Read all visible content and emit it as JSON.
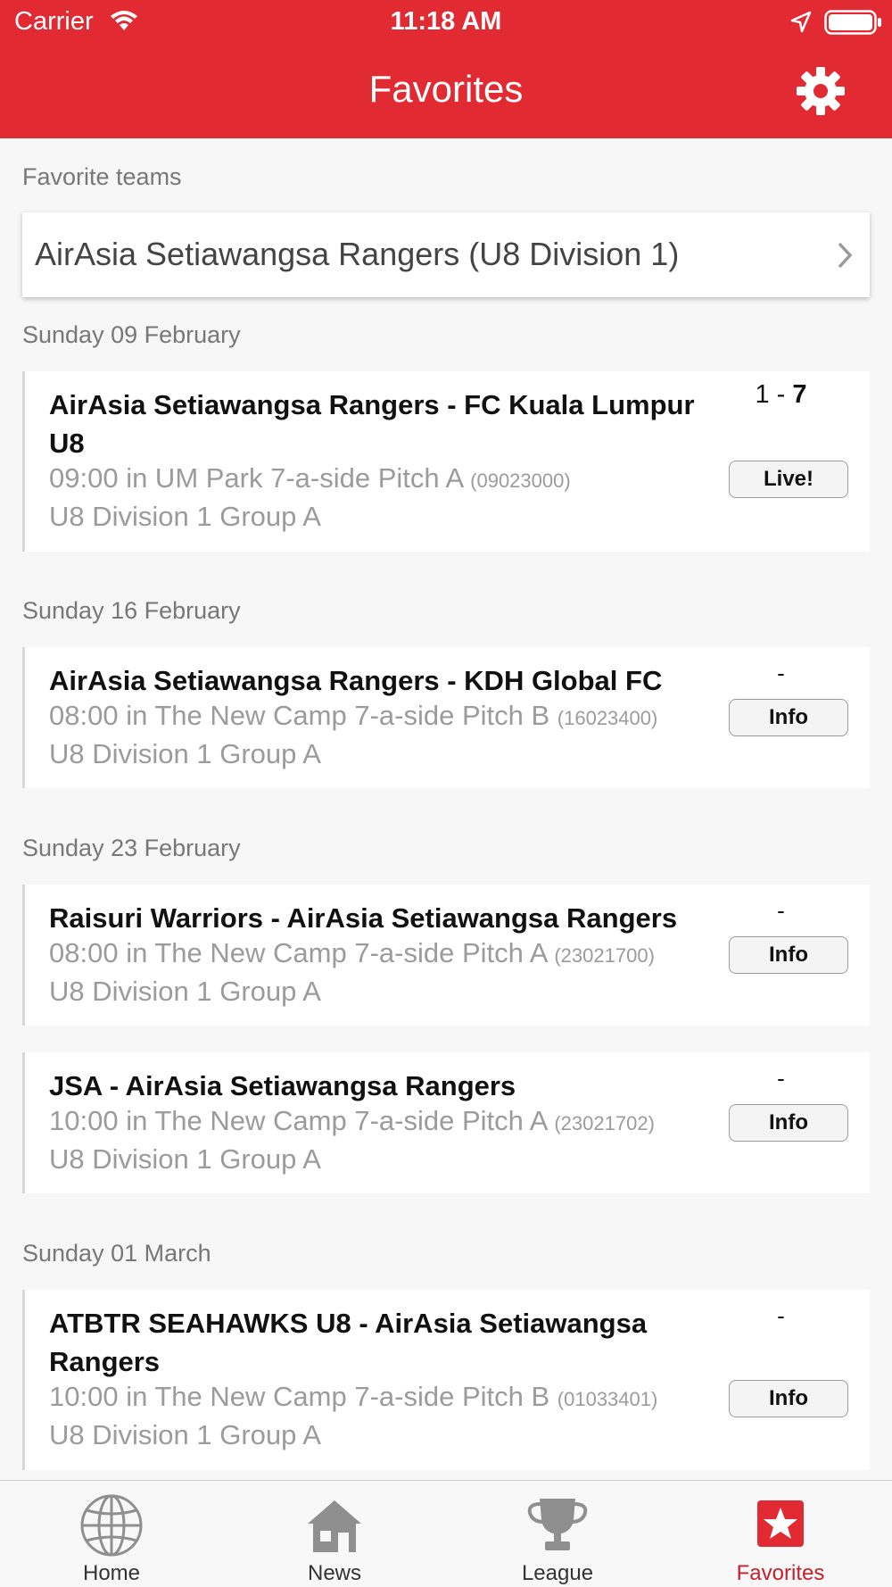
{
  "status_bar": {
    "carrier": "Carrier",
    "time": "11:18 AM"
  },
  "nav": {
    "title": "Favorites"
  },
  "favorite_teams": {
    "label": "Favorite teams",
    "teams": [
      "AirAsia Setiawangsa Rangers (U8 Division 1)"
    ]
  },
  "days": [
    {
      "date": "Sunday 09 February",
      "matches": [
        {
          "title": "AirAsia Setiawangsa Rangers - FC Kuala Lumpur U8",
          "time_place": "09:00 in UM Park 7-a-side Pitch A",
          "code": "(09023000)",
          "group": "U8 Division 1 Group A",
          "score_home": "1",
          "score_sep": " - ",
          "score_away": "7",
          "button": "Live!"
        }
      ]
    },
    {
      "date": "Sunday 16 February",
      "matches": [
        {
          "title": "AirAsia Setiawangsa Rangers - KDH Global FC",
          "time_place": "08:00 in The New Camp 7-a-side Pitch B",
          "code": "(16023400)",
          "group": "U8 Division 1 Group A",
          "score": "-",
          "button": "Info"
        }
      ]
    },
    {
      "date": "Sunday 23 February",
      "matches": [
        {
          "title": "Raisuri Warriors - AirAsia Setiawangsa Rangers",
          "time_place": "08:00 in The New Camp 7-a-side Pitch A",
          "code": "(23021700)",
          "group": "U8 Division 1 Group A",
          "score": "-",
          "button": "Info"
        },
        {
          "title": "JSA - AirAsia Setiawangsa Rangers",
          "time_place": "10:00 in The New Camp 7-a-side Pitch A",
          "code": "(23021702)",
          "group": "U8 Division 1 Group A",
          "score": "-",
          "button": "Info"
        }
      ]
    },
    {
      "date": "Sunday 01 March",
      "matches": [
        {
          "title": "ATBTR SEAHAWKS U8 - AirAsia Setiawangsa Rangers",
          "time_place": "10:00 in The New Camp 7-a-side Pitch B",
          "code": "(01033401)",
          "group": "U8 Division 1 Group A",
          "score": "-",
          "button": "Info"
        }
      ]
    }
  ],
  "tabs": [
    {
      "label": "Home",
      "icon": "globe-icon"
    },
    {
      "label": "News",
      "icon": "house-icon"
    },
    {
      "label": "League",
      "icon": "trophy-icon"
    },
    {
      "label": "Favorites",
      "icon": "star-icon",
      "active": true
    }
  ],
  "colors": {
    "accent": "#e22a33",
    "active_tab": "#c6202a"
  }
}
